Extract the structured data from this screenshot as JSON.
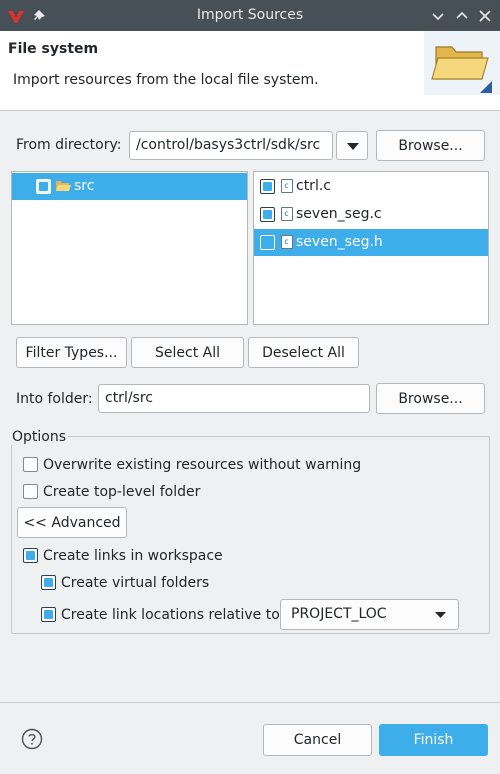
{
  "window": {
    "title": "Import Sources"
  },
  "header": {
    "title": "File system",
    "description": "Import resources from the local file system."
  },
  "from_directory": {
    "label": "From directory:",
    "value": "/control/basys3ctrl/sdk/src",
    "browse_label": "Browse..."
  },
  "folder_tree": {
    "items": [
      {
        "label": "src",
        "checked": true,
        "selected": true
      }
    ]
  },
  "file_list": {
    "items": [
      {
        "label": "ctrl.c",
        "checked": true,
        "selected": false
      },
      {
        "label": "seven_seg.c",
        "checked": true,
        "selected": false
      },
      {
        "label": "seven_seg.h",
        "checked": false,
        "selected": true
      }
    ]
  },
  "selection_buttons": {
    "filter_types": "Filter Types...",
    "select_all": "Select All",
    "deselect_all": "Deselect All"
  },
  "into_folder": {
    "label": "Into folder:",
    "value": "ctrl/src",
    "browse_label": "Browse..."
  },
  "options": {
    "title": "Options",
    "overwrite": {
      "label": "Overwrite existing resources without warning",
      "checked": false
    },
    "top_level": {
      "label": "Create top-level folder",
      "checked": false
    },
    "advanced_label": "<< Advanced",
    "create_links": {
      "label": "Create links in workspace",
      "checked": true
    },
    "virtual_folders": {
      "label": "Create virtual folders",
      "checked": true
    },
    "relative_to": {
      "label": "Create link locations relative to:",
      "checked": true,
      "value": "PROJECT_LOC"
    }
  },
  "footer": {
    "cancel_label": "Cancel",
    "finish_label": "Finish"
  },
  "colors": {
    "titlebar": "#475057",
    "accent": "#3daee9",
    "window_bg": "#eff0f1"
  }
}
